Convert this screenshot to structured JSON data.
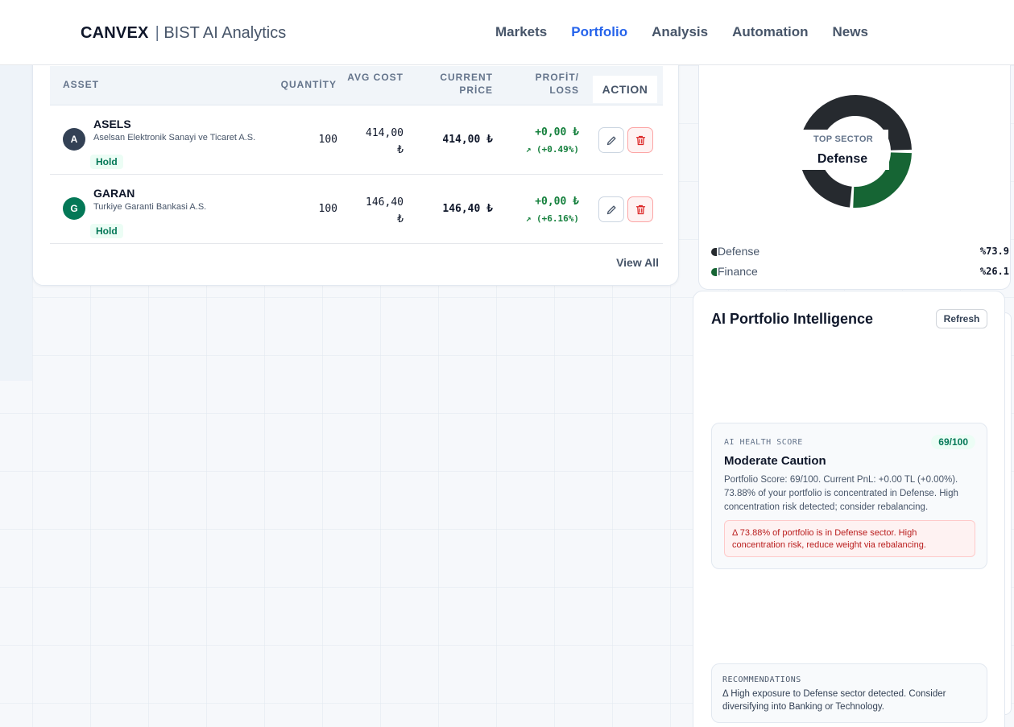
{
  "nav": {
    "brand": "CANVEX",
    "brand_separator": "|",
    "brand_subtitle": "BIST AI Analytics",
    "links": [
      {
        "label": "Markets",
        "active": false
      },
      {
        "label": "Portfolio",
        "active": true
      },
      {
        "label": "Analysis",
        "active": false
      },
      {
        "label": "Automation",
        "active": false
      },
      {
        "label": "News",
        "active": false
      }
    ]
  },
  "holdings": {
    "headers": {
      "asset": "ASSET",
      "quantity": "QUANTİTY",
      "avg_cost": "AVG COST",
      "current_price": "CURRENT PRİCE",
      "profit_loss": "PROFİT/ LOSS",
      "action": "ACTION"
    },
    "rows": [
      {
        "avatar": "A",
        "avatar_color": "#334155",
        "ticker": "ASELS",
        "company": "Aselsan Elektronik Sanayi ve Ticaret A.S.",
        "badge": "Hold",
        "quantity": "100",
        "avg_cost_value": "414,00",
        "avg_cost_currency": "₺",
        "current_price": "414,00 ₺",
        "pl_value": "+0,00 ₺",
        "pl_percent": "↗ (+0.49%)"
      },
      {
        "avatar": "G",
        "avatar_color": "#047857",
        "ticker": "GARAN",
        "company": "Turkiye Garanti Bankasi A.S.",
        "badge": "Hold",
        "quantity": "100",
        "avg_cost_value": "146,40",
        "avg_cost_currency": "₺",
        "current_price": "146,40 ₺",
        "pl_value": "+0,00 ₺",
        "pl_percent": "↗ (+6.16%)"
      }
    ],
    "view_all": "View All"
  },
  "sector": {
    "top_label": "TOP SECTOR",
    "top_name": "Defense",
    "items": [
      {
        "name": "Defense",
        "percent": "%73.9",
        "value": 73.9,
        "color": "#262a2f"
      },
      {
        "name": "Finance",
        "percent": "%26.1",
        "value": 26.1,
        "color": "#166534"
      }
    ]
  },
  "ai": {
    "title": "AI Portfolio Intelligence",
    "refresh": "Refresh",
    "health_label": "AI HEALTH SCORE",
    "health_score": "69/100",
    "health_title": "Moderate Caution",
    "health_body": "Portfolio Score: 69/100. Current PnL: +0.00 TL (+0.00%). 73.88% of your portfolio is concentrated in Defense. High concentration risk detected; consider rebalancing.",
    "warning": "Δ 73.88% of portfolio is in Defense sector. High concentration risk, reduce weight via rebalancing.",
    "reco_label": "RECOMMENDATIONS",
    "reco_text": "Δ High exposure to Defense sector detected. Consider diversifying into Banking or Technology."
  }
}
